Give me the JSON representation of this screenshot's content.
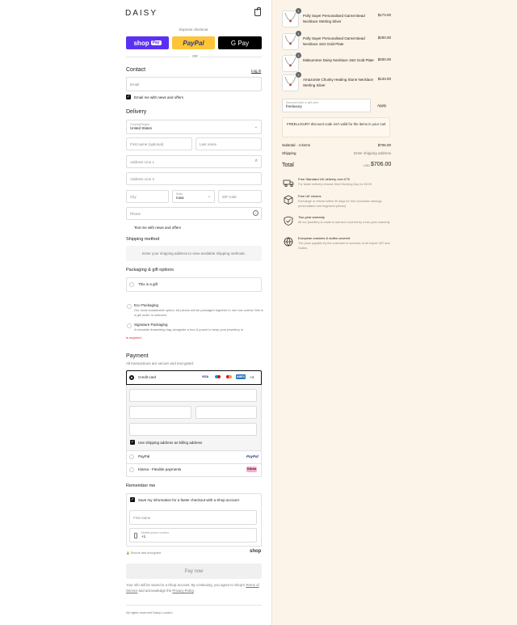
{
  "header": {
    "logo": "DAISY"
  },
  "express": {
    "title": "Express checkout",
    "shoppay_label": "shop",
    "shoppay_suffix": "Pay",
    "paypal_label": "PayPal",
    "gpay_label": "G Pay",
    "or_label": "OR"
  },
  "contact": {
    "heading": "Contact",
    "login_link": "Log in",
    "email_placeholder": "Email",
    "news_label": "Email me with news and offers"
  },
  "delivery": {
    "heading": "Delivery",
    "country_label": "Country/Region",
    "country_value": "United States",
    "first_name": "First name (optional)",
    "last_name": "Last name",
    "address1": "Address Line 1",
    "address2": "Address Line 2",
    "city": "City",
    "state_label": "State",
    "state_value": "Iowa",
    "zip": "ZIP code",
    "phone": "Phone",
    "text_news": "Text me with news and offers"
  },
  "shipping": {
    "heading": "Shipping method",
    "placeholder": "Enter your shipping address to view available shipping methods."
  },
  "packaging": {
    "heading": "Packaging & gift options",
    "gift_label": "This is a gift",
    "eco_title": "Eco Packaging",
    "eco_text": "Our most sustainable option. All pieces will be packaged together in one box unless 'this is a gift order' is selected.",
    "sig_title": "Signature Packaging",
    "sig_text": "A reusable drawstring bag alongside a box & pouch to keep your jewellery in",
    "required": "is required"
  },
  "payment": {
    "heading": "Payment",
    "subtitle": "All transactions are secure and encrypted.",
    "credit_card": "Credit card",
    "card_more": "+4",
    "billing_label": "Use shipping address as billing address",
    "paypal": "PayPal",
    "paypal_logo": "PayPal",
    "klarna": "Klarna - Flexible payments",
    "klarna_logo": "Klarna"
  },
  "remember": {
    "heading": "Remember me",
    "save_label": "Save my information for a faster checkout with a Shop account",
    "first_name": "First name",
    "mobile_label": "Mobile phone number",
    "mobile_value": "+1",
    "secure": "Secure and encrypted",
    "shop_logo": "shop"
  },
  "pay_button": "Pay now",
  "legal": {
    "prefix": "Your info will be saved to a Shop account. By continuing, you agree to Shop's ",
    "terms": "Terms of Service",
    "mid": " and acknowledge the ",
    "privacy": "Privacy Policy",
    "suffix": "."
  },
  "footer": "All rights reserved Daisy London",
  "order": {
    "items": [
      {
        "qty": "1",
        "name": "Polly Sayer Personalised Garnet Bead Necklace Sterling Silver",
        "price": "$173.00"
      },
      {
        "qty": "1",
        "name": "Polly Sayer Personalised Garnet Bead Necklace 18ct Gold Plate",
        "price": "$200.00"
      },
      {
        "qty": "1",
        "name": "Midsummer Daisy Necklace 18ct Gold Plate",
        "price": "$200.00"
      },
      {
        "qty": "1",
        "name": "Amazonite Chunky Healing Stone Necklace Sterling Silver",
        "price": "$133.00"
      }
    ],
    "discount_label": "Discount code or gift card",
    "discount_value": "freeluxury",
    "apply": "Apply",
    "discount_error": "FREELUXURY discount code isn't valid for the items in your cart",
    "subtotal_label": "Subtotal · 4 items",
    "subtotal_value": "$706.00",
    "shipping_label": "Shipping",
    "shipping_value": "Enter shipping address",
    "total_label": "Total",
    "currency": "USD",
    "total_value": "$706.00"
  },
  "perks": [
    {
      "icon": "truck-icon",
      "title": "Free Standard UK delivery over £75",
      "text": "For faster delivery choose Next Working Day for £5.95"
    },
    {
      "icon": "box-icon",
      "title": "Free UK returns",
      "text": "Exchange or refund within 30 days for free (excludes earrings, personalised and engraved pieces)"
    },
    {
      "icon": "shield-icon",
      "title": "Two-year warranty",
      "text": "All our jewellery is made to last and covered by a two-year warranty"
    },
    {
      "icon": "globe-icon",
      "title": "European customs & duties covered",
      "text": "The price payable by the customer is inclusive of all import VAT and Duties."
    }
  ]
}
